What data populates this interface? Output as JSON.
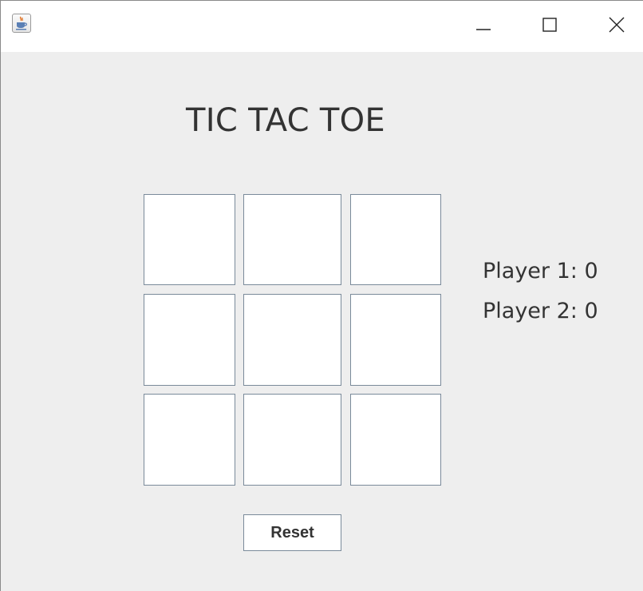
{
  "window": {
    "title": "",
    "icon": "java-cup-icon",
    "controls": {
      "minimize": "minimize-icon",
      "maximize": "maximize-icon",
      "close": "close-icon"
    }
  },
  "game": {
    "title": "TIC TAC TOE",
    "cells": [
      "",
      "",
      "",
      "",
      "",
      "",
      "",
      "",
      ""
    ]
  },
  "scores": {
    "player1": "Player 1: 0",
    "player2": "Player 2: 0"
  },
  "buttons": {
    "reset": "Reset"
  }
}
